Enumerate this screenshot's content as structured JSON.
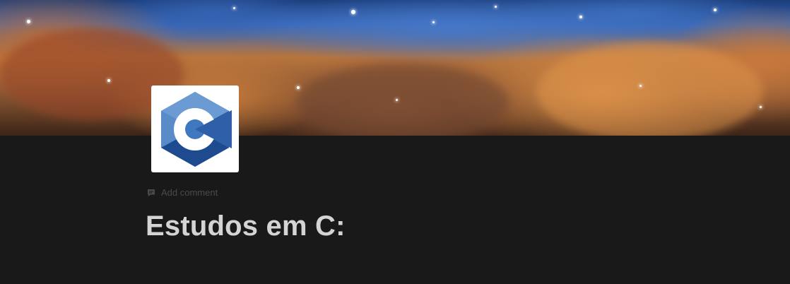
{
  "page": {
    "title": "Estudos em C:",
    "add_comment_label": "Add comment"
  },
  "icons": {
    "page_icon": "c-language-icon",
    "comment_icon": "comment-icon"
  },
  "colors": {
    "background": "#191919",
    "title_text": "#d4d4d4",
    "muted_text": "#4a4a4a",
    "c_logo_light": "#6b9bd2",
    "c_logo_mid": "#3f78bf",
    "c_logo_dark": "#1e4b8f"
  }
}
